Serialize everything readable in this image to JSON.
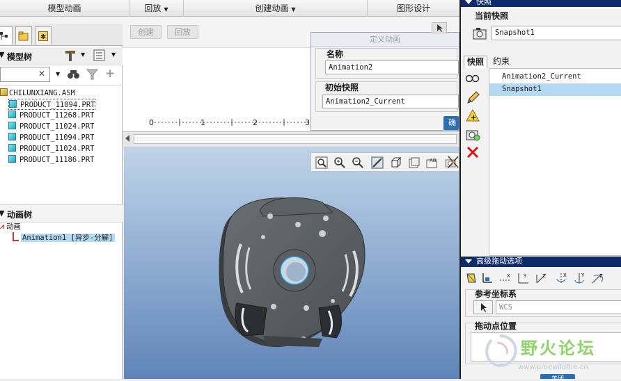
{
  "menubar": {
    "items": [
      {
        "label": "模型动画",
        "caret": ""
      },
      {
        "label": "回放",
        "caret": "▼"
      },
      {
        "label": "创建动画",
        "caret": "▼"
      },
      {
        "label": "图形设计",
        "caret": ""
      }
    ]
  },
  "timeline_toolbar": {
    "create_label": "创建",
    "playback_label": "回放"
  },
  "timeline": {
    "ticks": [
      "0",
      "1",
      "2",
      "3"
    ]
  },
  "model_tree": {
    "title": "模型树",
    "search_placeholder": "",
    "clear_glyph": "✕",
    "root": "CHILUNXIANG.ASM",
    "parts": [
      "PRODUCT_11094.PRT",
      "PRODUCT_11268.PRT",
      "PRODUCT_11024.PRT",
      "PRODUCT_11094.PRT",
      "PRODUCT_11024.PRT",
      "PRODUCT_11186.PRT"
    ]
  },
  "animation_tree": {
    "title": "动画树",
    "root_label": "动画",
    "item_label": "Animation1 [异步-分解]"
  },
  "define_dialog": {
    "title": "定义动画",
    "name_label": "名称",
    "name_value": "Animation2",
    "initial_snapshot_label": "初始快照",
    "initial_snapshot_value": "Animation2_Current",
    "ok_label": "确"
  },
  "snapshot_panel": {
    "title": "快照",
    "current_snapshot_label": "当前快照",
    "snapshot_name_value": "Snapshot1",
    "tabs": [
      "快照",
      "约束"
    ],
    "list_items": [
      "Animation2_Current",
      "Snapshot1"
    ],
    "selected_index": 1
  },
  "drag_panel": {
    "title": "高级拖动选项",
    "ref_coord_label": "参考坐标系",
    "coord_value": "WCS",
    "drag_point_label": "拖动点位置",
    "bottom_button_label": "关闭"
  },
  "watermark": {
    "text": "野火论坛",
    "url": "www.proewildfire.cn"
  },
  "colors": {
    "selection": "#b4d9f2",
    "title_bar": "#0d2a6b",
    "watermark": "#8fd36b"
  }
}
